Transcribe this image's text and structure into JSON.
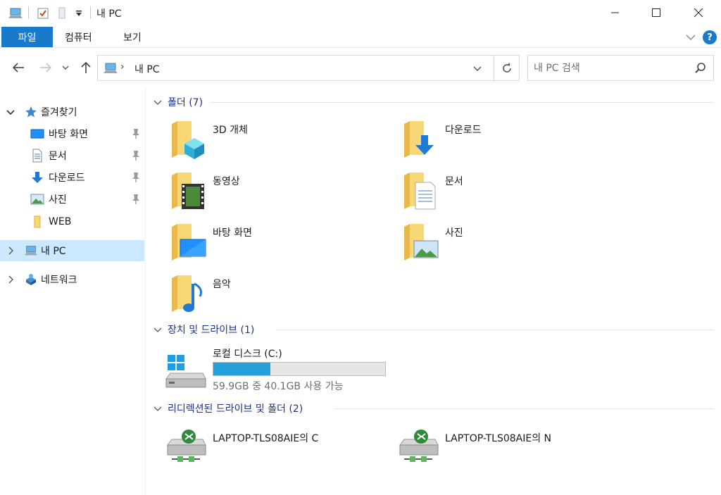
{
  "window": {
    "title": "내 PC"
  },
  "ribbon": {
    "file_tab": "파일",
    "tabs": [
      "컴퓨터",
      "보기"
    ],
    "help": "?"
  },
  "nav": {
    "address_location": "내 PC",
    "search_placeholder": "내 PC 검색"
  },
  "sidebar": {
    "quick_access_label": "즐겨찾기",
    "quick_items": [
      {
        "label": "바탕 화면",
        "icon": "desktop-icon",
        "pinned": true
      },
      {
        "label": "문서",
        "icon": "document-icon",
        "pinned": true
      },
      {
        "label": "다운로드",
        "icon": "download-icon",
        "pinned": true
      },
      {
        "label": "사진",
        "icon": "picture-icon",
        "pinned": true
      },
      {
        "label": "WEB",
        "icon": "folder-icon",
        "pinned": false
      }
    ],
    "this_pc_label": "내 PC",
    "network_label": "네트워크"
  },
  "content": {
    "folders_group": "폴더 (7)",
    "folders": [
      {
        "label": "3D 개체",
        "icon": "3d-objects-icon"
      },
      {
        "label": "다운로드",
        "icon": "download-folder-icon"
      },
      {
        "label": "동영상",
        "icon": "video-folder-icon"
      },
      {
        "label": "문서",
        "icon": "document-folder-icon"
      },
      {
        "label": "바탕 화면",
        "icon": "desktop-folder-icon"
      },
      {
        "label": "사진",
        "icon": "picture-folder-icon"
      },
      {
        "label": "음악",
        "icon": "music-folder-icon"
      }
    ],
    "devices_group": "장치 및 드라이브 (1)",
    "drive": {
      "name": "로컬 디스크 (C:)",
      "space": "59.9GB 중 40.1GB 사용 가능",
      "used_fraction": 0.33
    },
    "network_group": "리디렉션된 드라이브 및 폴더 (2)",
    "network_drives": [
      {
        "label": "LAPTOP-TLS08AIE의 C"
      },
      {
        "label": "LAPTOP-TLS08AIE의 N"
      }
    ]
  },
  "colors": {
    "accent": "#1979ca",
    "selection": "#cce8ff",
    "group_header": "#1e3287",
    "drive_fill": "#26a0da",
    "folder": "#f8d775"
  }
}
